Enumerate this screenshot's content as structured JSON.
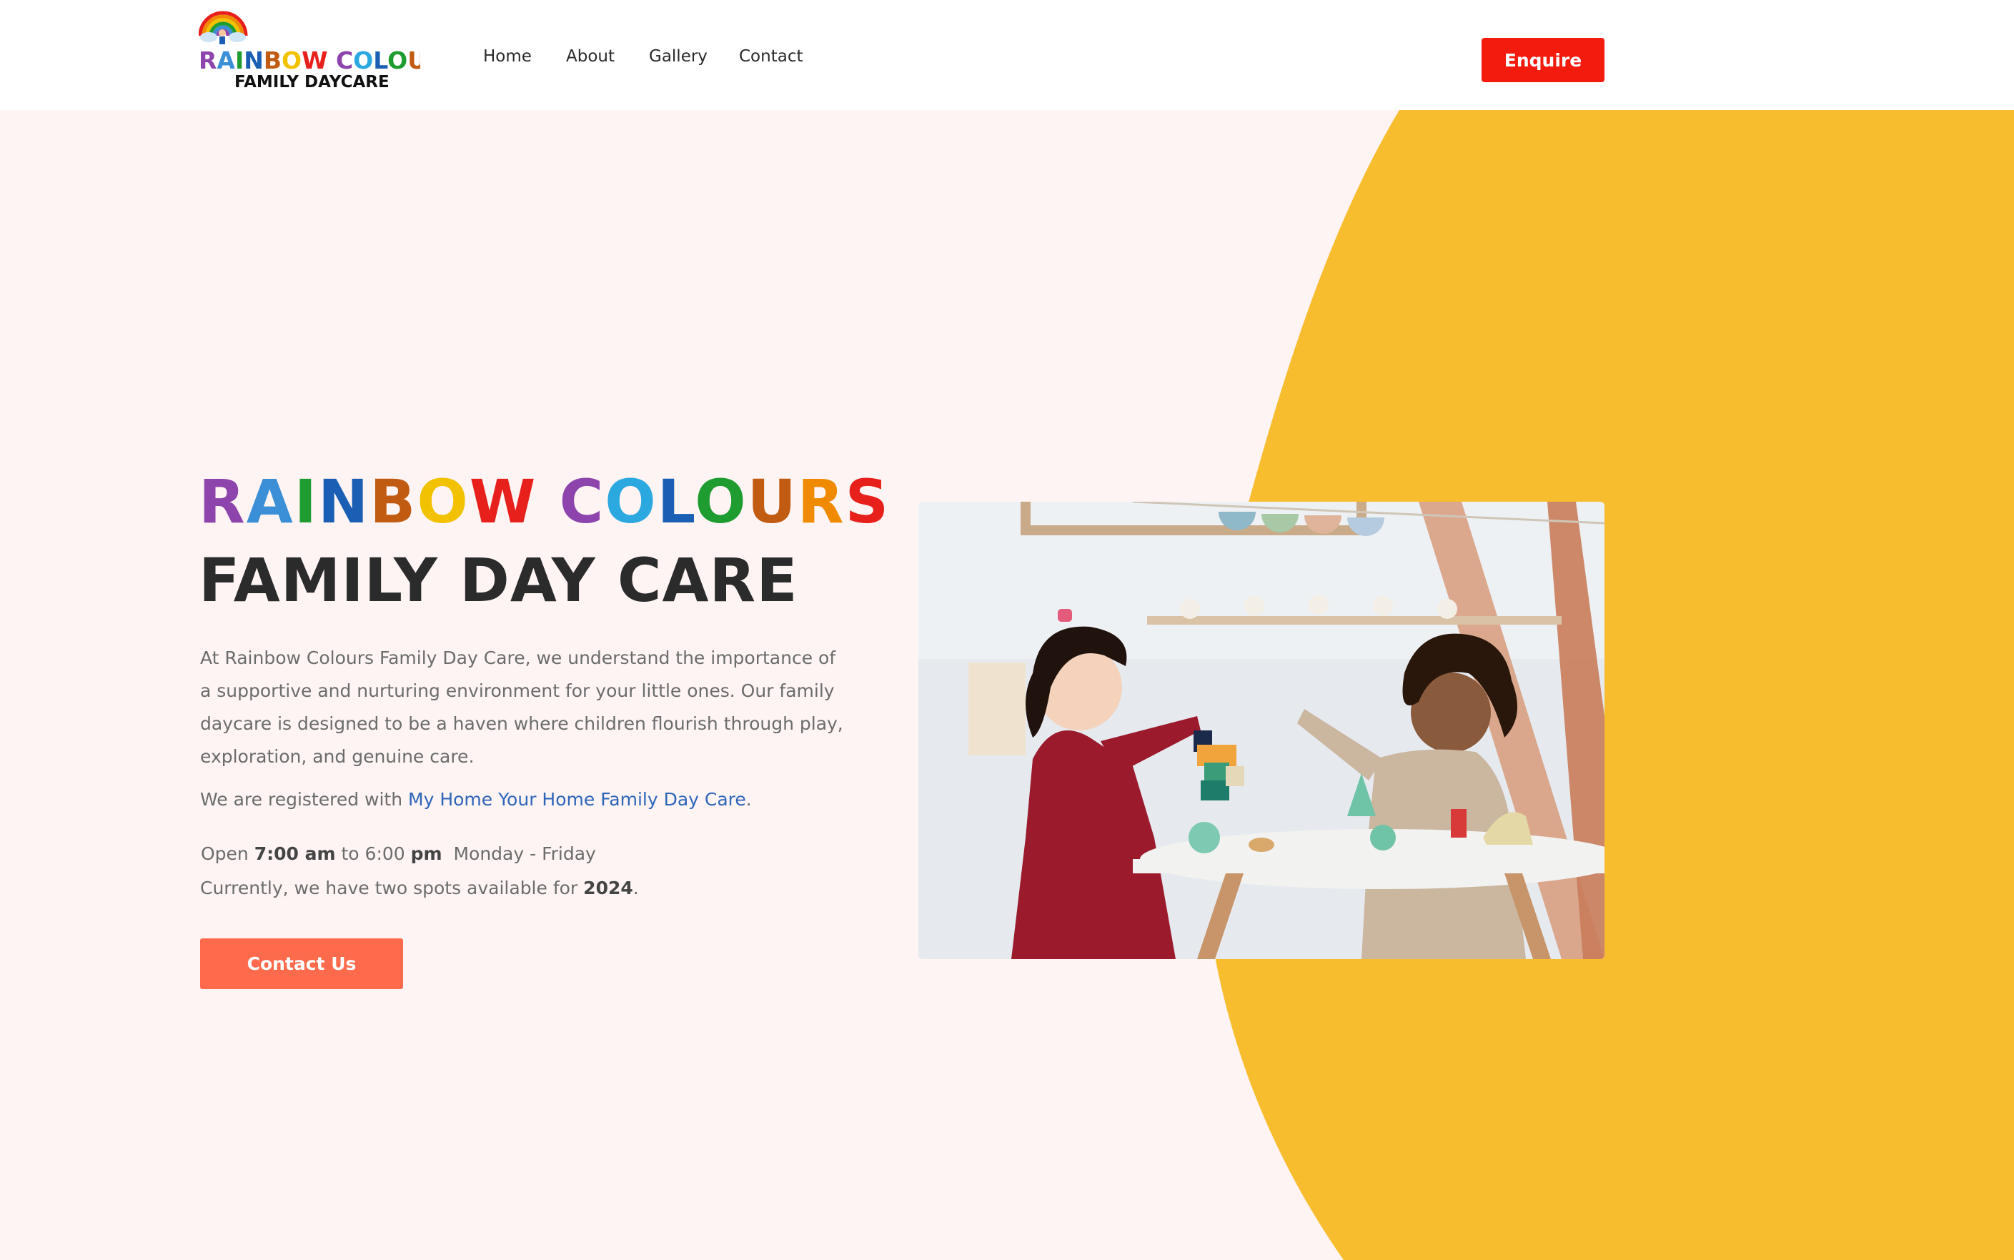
{
  "header": {
    "logo_line1": "RAINBOW COLOURS",
    "logo_line2": "FAMILY DAYCARE",
    "nav": [
      {
        "label": "Home"
      },
      {
        "label": "About"
      },
      {
        "label": "Gallery"
      },
      {
        "label": "Contact"
      }
    ],
    "enquire_label": "Enquire"
  },
  "hero": {
    "title_letters": [
      "R",
      "A",
      "I",
      "N",
      "B",
      "O",
      "W",
      " ",
      "C",
      "O",
      "L",
      "O",
      "U",
      "R",
      "S"
    ],
    "title_line2": "FAMILY DAY CARE",
    "intro": "At Rainbow Colours Family Day Care, we understand the importance of a supportive and nurturing environment for your little ones. Our family daycare is designed to be a haven where children flourish through play, exploration, and genuine care.",
    "registered_prefix": "We are registered with ",
    "registered_link": "My Home Your Home Family Day Care",
    "registered_suffix": ".",
    "hours_open": "Open ",
    "hours_start": "7:00 am",
    "hours_to": " to 6:00 ",
    "hours_pm": "pm",
    "hours_days": "  Monday - Friday",
    "spots_prefix": "Currently, we have two spots available for ",
    "spots_year": "2024",
    "spots_suffix": ".",
    "contact_label": "Contact Us"
  },
  "colors": {
    "header_bg": "#ffffff",
    "page_bg": "#fdf4f3",
    "accent_yellow": "#f8bd2f",
    "enquire_red": "#f21b0e",
    "contact_orange": "#fe6b4c",
    "link_blue": "#2f65b9",
    "rainbow": [
      "#8e44ad",
      "#3b8fd6",
      "#1f9c2f",
      "#1a5fb4",
      "#c15b12",
      "#f2c200",
      "#e8201b",
      "#8e44ad",
      "#2ca8e0",
      "#1a5fb4",
      "#1f9c2f",
      "#c15b12",
      "#f08a00",
      "#e8201b"
    ]
  }
}
